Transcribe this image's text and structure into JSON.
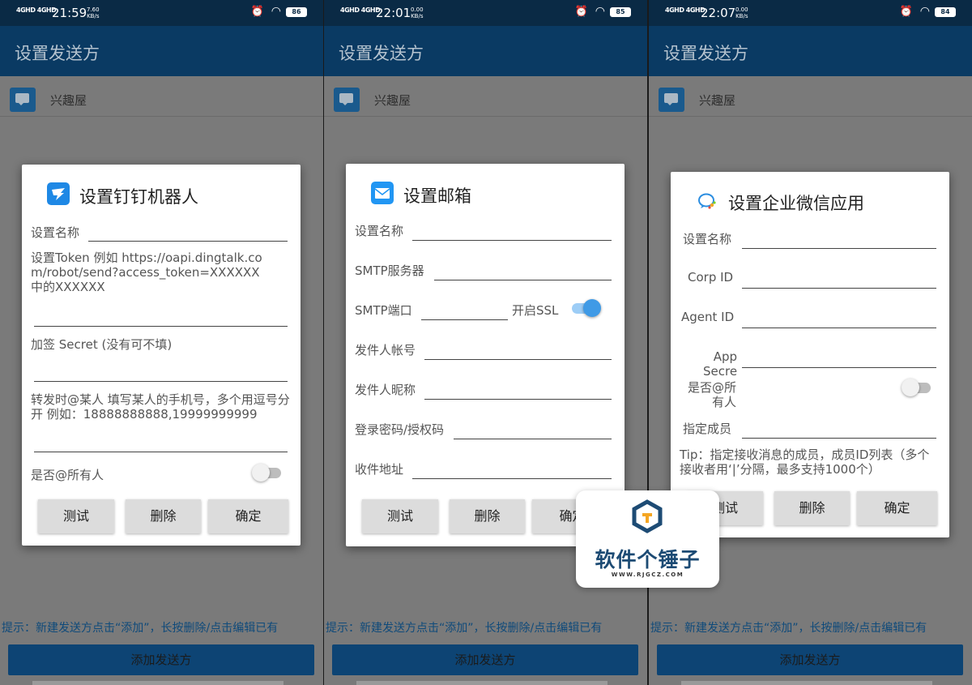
{
  "panels": [
    {
      "status": {
        "signal": "4GHD 4GHD",
        "time": "21:59",
        "speed_value": "7.60",
        "speed_unit": "KB/s",
        "battery": "86"
      },
      "app_title": "设置发送方",
      "row_label": "兴趣屋",
      "hint": "提示：新建发送方点击“添加”，长按删除/点击编辑已有",
      "add_button": "添加发送方"
    },
    {
      "status": {
        "signal": "4GHD 4GHD",
        "time": "22:01",
        "speed_value": "0.00",
        "speed_unit": "KB/s",
        "battery": "85"
      },
      "app_title": "设置发送方",
      "row_label": "兴趣屋",
      "hint": "提示：新建发送方点击“添加”，长按删除/点击编辑已有",
      "add_button": "添加发送方"
    },
    {
      "status": {
        "signal": "4GHD 4GHD",
        "time": "22:07",
        "speed_value": "0.00",
        "speed_unit": "KB/s",
        "battery": "84"
      },
      "app_title": "设置发送方",
      "row_label": "兴趣屋",
      "hint": "提示：新建发送方点击“添加”，长按删除/点击编辑已有",
      "add_button": "添加发送方"
    }
  ],
  "dingtalk_dialog": {
    "title": "设置钉钉机器人",
    "name_label": "设置名称",
    "token_label": "设置Token 例如 https://oapi.dingtalk.com/robot/send?access_token=XXXXXX 中的XXXXXX",
    "secret_label": "加签 Secret (没有可不填)",
    "at_mobiles_label": "转发时@某人 填写某人的手机号，多个用逗号分开 例如：18888888888,19999999999",
    "at_all_label": "是否@所有人",
    "at_all_enabled": false,
    "buttons": {
      "test": "测试",
      "delete": "删除",
      "ok": "确定"
    }
  },
  "email_dialog": {
    "title": "设置邮箱",
    "name_label": "设置名称",
    "smtp_server_label": "SMTP服务器",
    "smtp_port_label": "SMTP端口",
    "ssl_label": "开启SSL",
    "ssl_enabled": true,
    "sender_account_label": "发件人帐号",
    "sender_nickname_label": "发件人昵称",
    "password_label": "登录密码/授权码",
    "recipient_label": "收件地址",
    "buttons": {
      "test": "测试",
      "delete": "删除",
      "ok": "确定"
    }
  },
  "wecom_dialog": {
    "title": "设置企业微信应用",
    "name_label": "设置名称",
    "corp_id_label": "Corp ID",
    "agent_id_label": "Agent ID",
    "app_secret_label": "App Secret",
    "at_all_label": "是否@所有人",
    "at_all_enabled": false,
    "member_label": "指定成员",
    "tip": "Tip：指定接收消息的成员，成员ID列表（多个接收者用‘|’分隔，最多支持1000个）",
    "buttons": {
      "test": "测试",
      "delete": "删除",
      "ok": "确定"
    }
  },
  "watermark": {
    "name": "软件个锤子",
    "url": "WWW.RJGCZ.COM"
  },
  "colors": {
    "app_bar": "#0a3a63",
    "status_bar": "#0a2a45",
    "add_button": "#0d4474",
    "hint_text": "#0f4a7a",
    "toggle_on": "#3f9ae6",
    "dingtalk_icon": "#1e88e5",
    "email_icon": "#2196f3"
  }
}
